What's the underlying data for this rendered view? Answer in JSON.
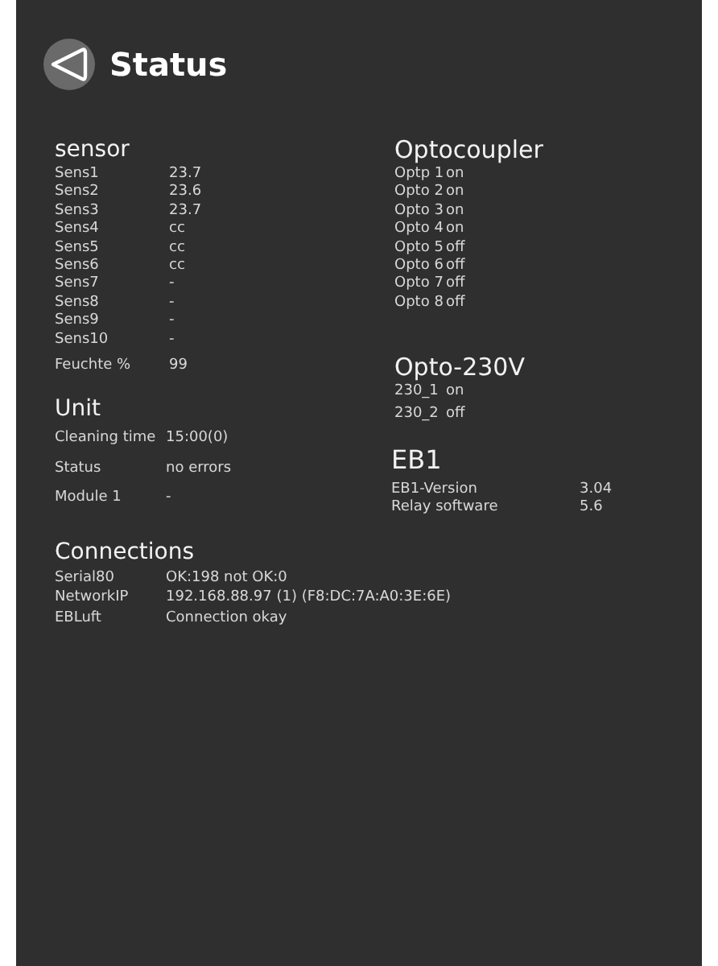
{
  "header": {
    "title": "Status"
  },
  "sensor": {
    "title": "sensor",
    "rows": [
      {
        "label": "Sens1",
        "value": "23.7"
      },
      {
        "label": "Sens2",
        "value": "23.6"
      },
      {
        "label": "Sens3",
        "value": "23.7"
      },
      {
        "label": "Sens4",
        "value": "cc"
      },
      {
        "label": "Sens5",
        "value": "cc"
      },
      {
        "label": "Sens6",
        "value": "cc"
      },
      {
        "label": "Sens7",
        "value": "-"
      },
      {
        "label": "Sens8",
        "value": "-"
      },
      {
        "label": "Sens9",
        "value": "-"
      },
      {
        "label": "Sens10",
        "value": "-"
      }
    ],
    "humidity": {
      "label": "Feuchte %",
      "value": "99"
    }
  },
  "unit": {
    "title": "Unit",
    "rows": [
      {
        "label": "Cleaning time",
        "value": "15:00(0)"
      },
      {
        "label": "Status",
        "value": "no errors"
      },
      {
        "label": "Module 1",
        "value": "-"
      }
    ]
  },
  "connections": {
    "title": "Connections",
    "rows": [
      {
        "label": "Serial80",
        "value": "OK:198 not OK:0"
      },
      {
        "label": "NetworkIP",
        "value": "192.168.88.97 (1) (F8:DC:7A:A0:3E:6E)"
      },
      {
        "label": "EBLuft",
        "value": "Connection okay"
      }
    ]
  },
  "optocoupler": {
    "title": "Optocoupler",
    "rows": [
      {
        "label": "Optp 1",
        "value": "on"
      },
      {
        "label": "Opto 2",
        "value": "on"
      },
      {
        "label": "Opto 3",
        "value": "on"
      },
      {
        "label": "Opto 4",
        "value": "on"
      },
      {
        "label": "Opto 5",
        "value": "off"
      },
      {
        "label": "Opto 6",
        "value": "off"
      },
      {
        "label": "Opto 7",
        "value": "off"
      },
      {
        "label": "Opto 8",
        "value": "off"
      }
    ]
  },
  "opto_230v": {
    "title": "Opto-230V",
    "rows": [
      {
        "label": "230_1",
        "value": "on"
      },
      {
        "label": "230_2",
        "value": "off"
      }
    ]
  },
  "eb1": {
    "title": "EB1",
    "rows": [
      {
        "label": "EB1-Version",
        "value": "3.04"
      },
      {
        "label": "Relay software",
        "value": "5.6"
      }
    ]
  }
}
